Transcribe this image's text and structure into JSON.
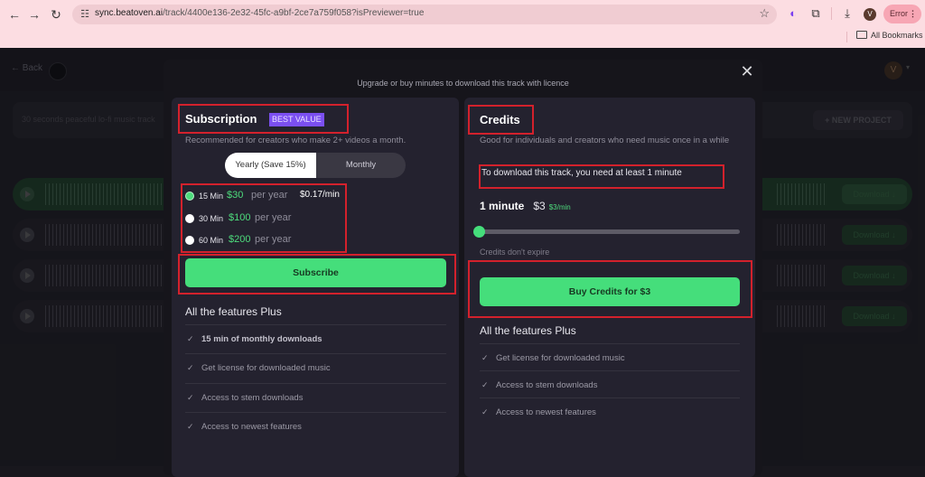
{
  "browser": {
    "url_host": "sync.beatoven.ai",
    "url_path": "/track/4400e136-2e32-45fc-a9bf-2ce7a759f058?isPreviewer=true",
    "profile_initial": "V",
    "error_label": "Error",
    "bookmarks_label": "All Bookmarks",
    "icons": {
      "back": "←",
      "forward": "→",
      "reload": "↻",
      "site_settings": "☷",
      "star": "☆",
      "extension": "◐",
      "puzzle": "⧉",
      "download": "⤓",
      "menu": "⋮"
    }
  },
  "app": {
    "back_label": "← Back",
    "prompt_text": "30 seconds peaceful lo-fi music track",
    "new_project_label": "+ NEW PROJECT",
    "user_initial": "V",
    "user_caret": "▾",
    "tracks": [
      {
        "download_label": "Download ↓",
        "active": true
      },
      {
        "download_label": "Download ↓",
        "active": false
      },
      {
        "download_label": "Download ↓",
        "active": false
      },
      {
        "download_label": "Download ↓",
        "active": false
      }
    ]
  },
  "modal": {
    "caption": "Upgrade or buy minutes to download this track with licence",
    "close_icon": "✕",
    "subscription": {
      "title": "Subscription",
      "badge": "BEST VALUE",
      "description": "Recommended for creators who make 2+ videos a month.",
      "billing_toggle": {
        "options": [
          "Yearly (Save 15%)",
          "Monthly"
        ],
        "selected": "Yearly (Save 15%)"
      },
      "plans": [
        {
          "minutes": "15 Min",
          "price": "$30",
          "period": "per year",
          "rate": "$0.17/min",
          "selected": true
        },
        {
          "minutes": "30 Min",
          "price": "$100",
          "period": "per year",
          "rate": "",
          "selected": false
        },
        {
          "minutes": "60 Min",
          "price": "$200",
          "period": "per year",
          "rate": "",
          "selected": false
        }
      ],
      "button_label": "Subscribe",
      "features_heading": "All the features Plus",
      "features": [
        {
          "text": "15 min of monthly downloads",
          "bold": true
        },
        {
          "text": "Get license for downloaded music",
          "bold": false
        },
        {
          "text": "Access to stem downloads",
          "bold": false
        },
        {
          "text": "Access to newest features",
          "bold": false
        }
      ]
    },
    "credits": {
      "title": "Credits",
      "description": "Good for individuals and creators who need music once in a while",
      "requirement": "To download this track, you need at least 1 minute",
      "amount_minutes": "1 minute",
      "amount_price": "$3",
      "price_per_min": "$3/min",
      "slider_value_fraction": 0,
      "note": "Credits don't expire",
      "button_label": "Buy Credits for $3",
      "features_heading": "All the features Plus",
      "features": [
        {
          "text": "Get license for downloaded music"
        },
        {
          "text": "Access to stem downloads"
        },
        {
          "text": "Access to newest features"
        }
      ]
    },
    "checkmark_icon": "✓",
    "highlight_color": "#d3212c",
    "accent_green": "#45de7b",
    "badge_color": "#7b4ff0"
  }
}
